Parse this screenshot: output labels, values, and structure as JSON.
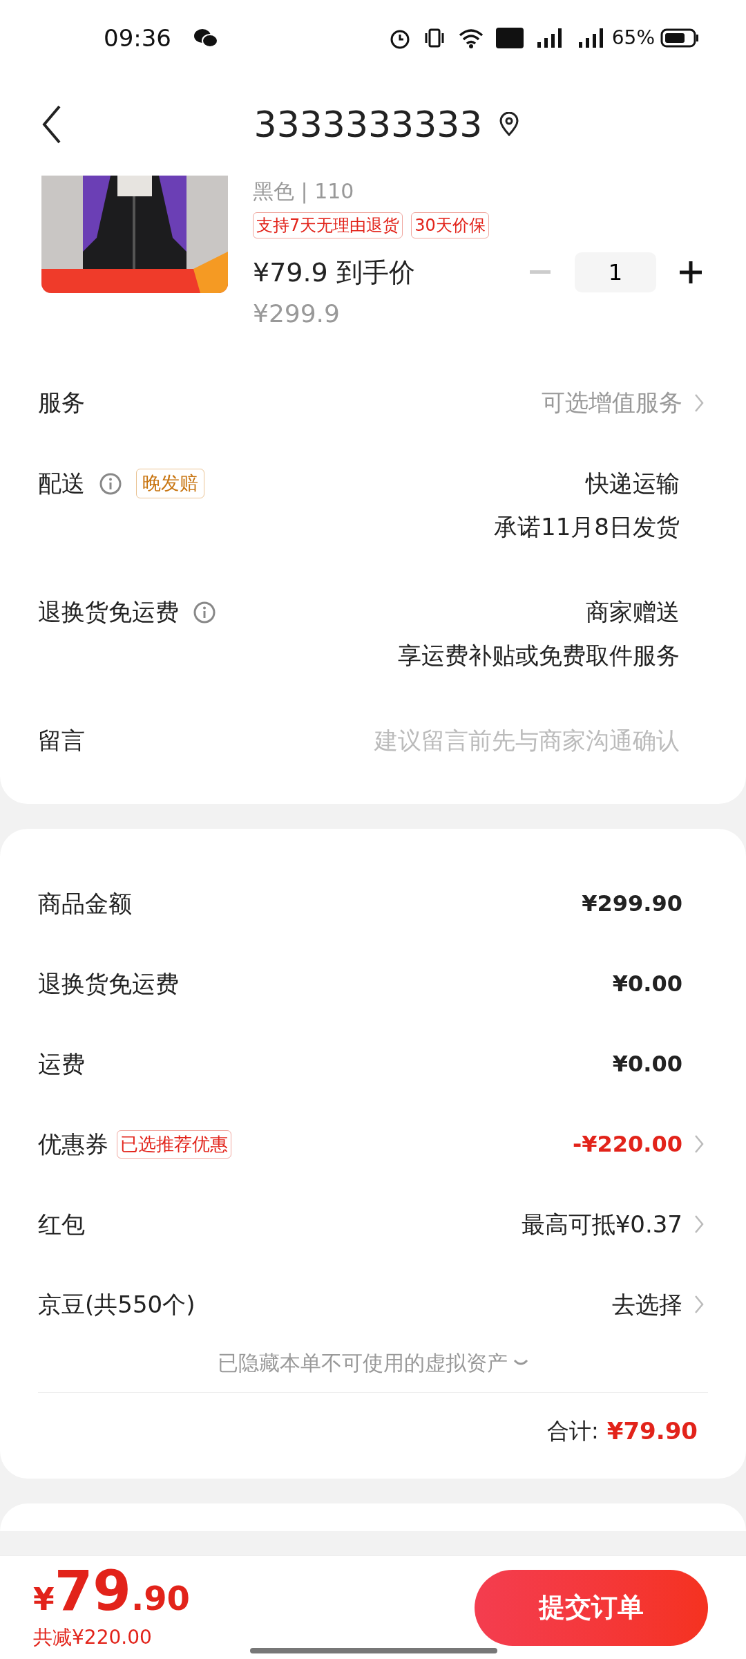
{
  "status_bar": {
    "time": "09:36",
    "battery": "65%"
  },
  "header": {
    "title": "3333333333"
  },
  "product": {
    "spec": "黑色 | 110",
    "tags": [
      "支持7天无理由退货",
      "30天价保"
    ],
    "price": "¥79.9",
    "price_label": "到手价",
    "original_price": "¥299.9",
    "quantity": "1"
  },
  "order_rows": [
    {
      "label": "服务",
      "value": "可选增值服务",
      "kind": "link"
    },
    {
      "label": "配送",
      "info": true,
      "badge": "晚发赔",
      "value": "快递运输",
      "sub": "承诺11月8日发货",
      "kind": "text"
    },
    {
      "label": "退换货免运费",
      "info": true,
      "value": "商家赠送",
      "sub": "享运费补贴或免费取件服务",
      "kind": "text"
    },
    {
      "label": "留言",
      "placeholder": "建议留言前先与商家沟通确认",
      "kind": "input"
    }
  ],
  "summary_rows": [
    {
      "label": "商品金额",
      "value": "¥299.90",
      "kind": "amount"
    },
    {
      "label": "退换货免运费",
      "value": "¥0.00",
      "kind": "amount"
    },
    {
      "label": "运费",
      "value": "¥0.00",
      "kind": "amount"
    },
    {
      "label": "优惠券",
      "badge": "已选推荐优惠",
      "value": "-¥220.00",
      "kind": "discount"
    },
    {
      "label": "红包",
      "value": "最高可抵¥0.37",
      "kind": "link"
    },
    {
      "label": "京豆(共550个)",
      "value": "去选择",
      "kind": "link"
    }
  ],
  "hidden_note": "已隐藏本单不可使用的虚拟资产",
  "total": {
    "label": "合计:",
    "value": "¥79.90"
  },
  "bottom_bar": {
    "currency": "¥",
    "integer": "79",
    "decimal": ".90",
    "saved": "共减¥220.00",
    "submit": "提交订单"
  }
}
